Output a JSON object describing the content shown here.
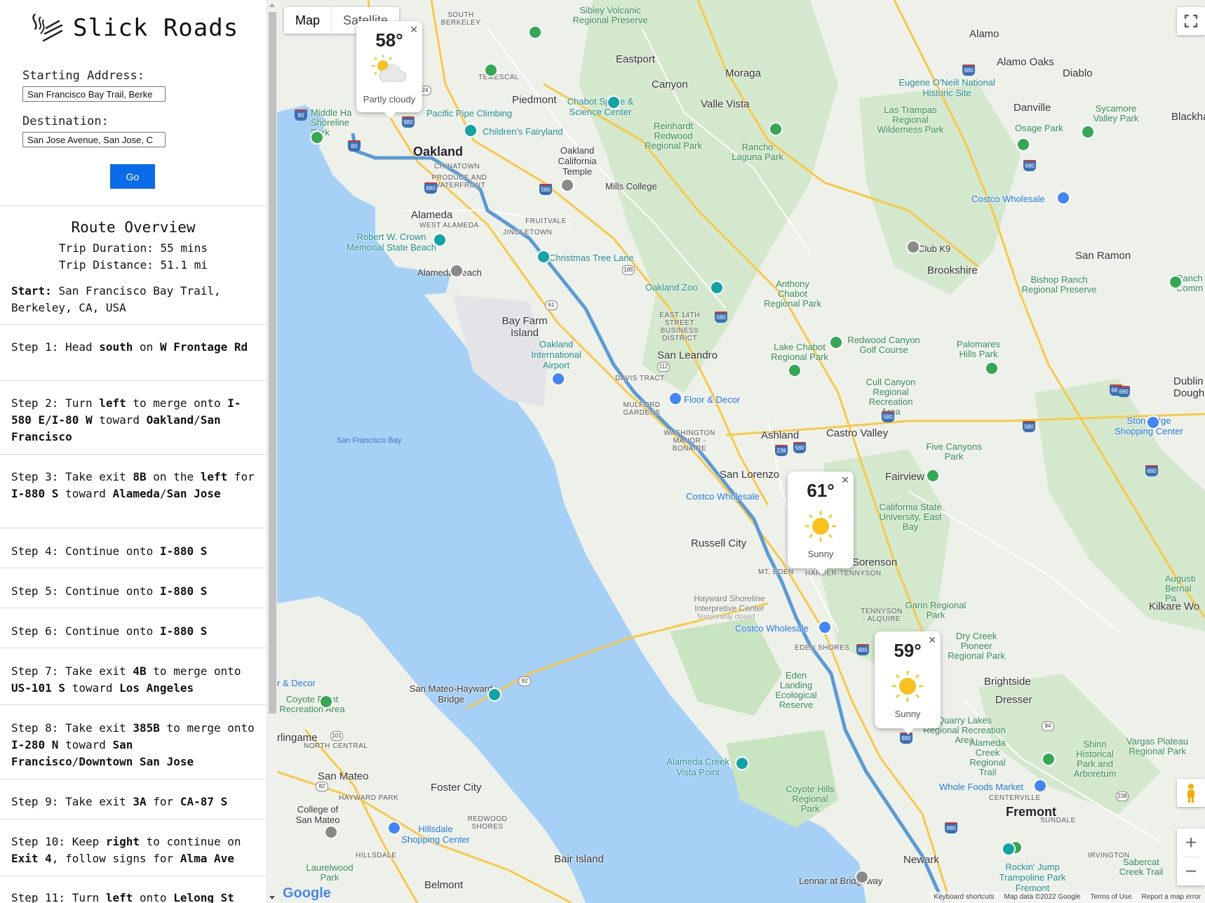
{
  "app": {
    "title": "Slick Roads"
  },
  "form": {
    "start_label": "Starting Address:",
    "start_value": "San Francisco Bay Trail, Berke",
    "dest_label": "Destination:",
    "dest_value": "San Jose Avenue, San Jose, C",
    "go_label": "Go"
  },
  "overview": {
    "title": "Route Overview",
    "duration": "Trip Duration: 55 mins",
    "distance": "Trip Distance: 51.1 mi",
    "start_label": "Start:",
    "start_value": "San Francisco Bay Trail, Berkeley, CA, USA"
  },
  "steps": [
    {
      "pre": "Step 1: Head ",
      "b1": "south",
      "m1": " on ",
      "b2": "W Frontage Rd",
      "m2": "",
      "b3": "",
      "m3": "",
      "b4": ""
    },
    {
      "pre": "Step 2: Turn ",
      "b1": "left",
      "m1": " to merge onto ",
      "b2": "I-580 E/I-80 W",
      "m2": " toward ",
      "b3": "Oakland",
      "m3": "/",
      "b4": "San Francisco"
    },
    {
      "pre": "Step 3: Take exit ",
      "b1": "8B",
      "m1": " on the ",
      "b2": "left",
      "m2": " for ",
      "b3": "I-880 S",
      "m3": " toward ",
      "b4": "Alameda",
      "m4": "/",
      "b5": "San Jose"
    },
    {
      "pre": "Step 4: Continue onto ",
      "b1": "I-880 S"
    },
    {
      "pre": "Step 5: Continue onto ",
      "b1": "I-880 S"
    },
    {
      "pre": "Step 6: Continue onto ",
      "b1": "I-880 S"
    },
    {
      "pre": "Step 7: Take exit ",
      "b1": "4B",
      "m1": " to merge onto ",
      "b2": "US-101 S",
      "m2": " toward ",
      "b3": "Los Angeles"
    },
    {
      "pre": "Step 8: Take exit ",
      "b1": "385B",
      "m1": " to merge onto ",
      "b2": "I-280 N",
      "m2": " toward ",
      "b3": "San Francisco",
      "m3": "/",
      "b4": "Downtown San Jose"
    },
    {
      "pre": "Step 9: Take exit ",
      "b1": "3A",
      "m1": " for ",
      "b2": "CA-87 S"
    },
    {
      "pre": "Step 10: Keep ",
      "b1": "right",
      "m1": " to continue on ",
      "b2": "Exit 4",
      "m2": ", follow signs for ",
      "b3": "Alma Ave"
    },
    {
      "pre": "Step 11: Turn ",
      "b1": "left",
      "m1": " onto ",
      "b2": "Lelong St"
    }
  ],
  "map": {
    "type_map": "Map",
    "type_satellite": "Satellite",
    "zoom_in": "+",
    "zoom_out": "−",
    "logo": "Google",
    "attribution": [
      "Keyboard shortcuts",
      "Map data ©2022 Google",
      "Terms of Use",
      "Report a map error"
    ],
    "route_color": "#5b9bd5",
    "weather": [
      {
        "temp": "58°",
        "desc": "Partly cloudy",
        "icon": "partly-cloudy-icon"
      },
      {
        "temp": "61°",
        "desc": "Sunny",
        "icon": "sun-icon"
      },
      {
        "temp": "59°",
        "desc": "Sunny",
        "icon": "sun-icon"
      }
    ],
    "labels": {
      "oakland": "Oakland",
      "fremont": "Fremont",
      "alameda": "Alameda",
      "san_leandro": "San Leandro",
      "castro_valley": "Castro Valley",
      "ashland": "Ashland",
      "san_lorenzo": "San Lorenzo",
      "russell_city": "Russell City",
      "sorenson": "Sorenson",
      "piedmont": "Piedmont",
      "moraga": "Moraga",
      "canyon": "Canyon",
      "eastport": "Eastport",
      "valle_vista": "Valle Vista",
      "alamo": "Alamo",
      "alamo_oaks": "Alamo Oaks",
      "diablo": "Diablo",
      "danville": "Danville",
      "san_ramon": "San Ramon",
      "brookshire": "Brookshire",
      "fairview": "Fairview",
      "newark": "Newark",
      "san_mateo": "San Mateo",
      "foster_city": "Foster City",
      "belmont": "Belmont",
      "brightside": "Brightside",
      "dresser": "Dresser",
      "kilkare_woods": "Kilkare Wo",
      "bay_farm": "Bay Farm Island",
      "bair_island": "Bair Island",
      "burlingame": "rlingame",
      "oakland_airport": "Oakland International Airport",
      "sf_bay": "San Francisco Bay",
      "eugene": "Eugene O'Neill National Historic Site",
      "las_trampas": "Las Trampas Regional Wilderness Park",
      "sycamore": "Sycamore Valley Park",
      "osage": "Osage Park",
      "costco1": "Costco Wholesale",
      "costco2": "Costco Wholesale",
      "costco3": "Costco Wholesale",
      "club_k9": "Club K9",
      "bishop": "Bishop Ranch Regional Preserve",
      "rancho": "Rancho Laguna Park",
      "reinhardt": "Reinhardt Redwood Regional Park",
      "oakland_temple": "Oakland California Temple",
      "chabot_space": "Chabot Space & Science Center",
      "mills": "Mills College",
      "childrens": "Children's Fairyland",
      "pacific_pipe": "Pacific Pipe Climbing",
      "middle_harbor": "Middle Ha Shoreline Park",
      "sibley": "Sibley Volcanic Regional Preserve",
      "chinatown": "CHINATOWN",
      "produce": "PRODUCE AND WATERFRONT",
      "temescal": "TEMESCAL",
      "south_berkeley": "SOUTH BERKELEY",
      "fruitvale": "FRUITVALE",
      "jingletown": "JINGLETOWN",
      "west_alameda": "WEST ALAMEDA",
      "robert_crown": "Robert W. Crown Memorial State Beach",
      "alameda_beach": "Alameda Beach",
      "christmas": "Christmas Tree Lane",
      "oakland_zoo": "Oakland Zoo",
      "anthony_chabot": "Anthony Chabot Regional Park",
      "redwood_canyon": "Redwood Canyon Golf Course",
      "palomares": "Palomares Hills Park",
      "lake_chabot": "Lake Chabot Regional Park",
      "cull_canyon": "Cull Canyon Regional Recreation Area",
      "five_canyons": "Five Canyons Park",
      "stoneridge": "Stoneridge Shopping Center",
      "floor_decor": "Floor & Decor",
      "floor_decor2": "r & Decor",
      "east14": "EAST 14TH STREET BUSINESS DISTRICT",
      "davis": "DAVIS TRACT",
      "mulford": "MULFORD GARDENS",
      "washington": "WASHINGTON MANOR - BONAIRE",
      "csu": "California State University, East Bay",
      "mt_eden": "MT. EDEN",
      "harder": "HARDER-TENNYSON",
      "tennyson": "TENNYSON - ALQUIRE",
      "eden_shores": "EDEN SHORES",
      "hayward_shoreline": "Hayward Shoreline Interpretive Center",
      "temp_closed": "Temporarily closed",
      "garin": "Garin Regional Park",
      "dry_creek": "Dry Creek Pioneer Regional Park",
      "eden_landing": "Eden Landing Ecological Reserve",
      "coyote_point": "Coyote Point Recreation Area",
      "san_mateo_bridge": "San Mateo-Hayward Bridge",
      "quarry": "Quarry Lakes Regional Recreation Area",
      "alameda_creek": "Alameda Creek Regional Trail",
      "shinn": "Shinn Historical Park and Arboretum",
      "vargas": "Vargas Plateau Regional Park",
      "alameda_creek_vista": "Alameda Creek Vista Point",
      "coyote_hills": "Coyote Hills Regional Park",
      "whole_foods": "Whole Foods Market",
      "centerville": "CENTERVILLE",
      "sundale": "SUNDALE",
      "irvington": "IRVINGTON",
      "rockin": "Rockin' Jump Trampoline Park Fremont",
      "sabercat": "Sabercat Creek Trail",
      "hillsdale": "Hillsdale Shopping Center",
      "college_sm": "College of San Mateo",
      "laurelwood": "Laurelwood Park",
      "hillsdale_n": "HILLSDALE",
      "hayward_park": "HAYWARD PARK",
      "north_central": "NORTH CENTRAL",
      "redwood_shores": "REDWOOD SHORES",
      "lennar": "Lennar at Bridgeway",
      "augusti": "Augusti Bernal Pa",
      "dublin": "Dublin Dougher",
      "blackha": "Blackha",
      "ranch": "Ranch Comm"
    }
  }
}
